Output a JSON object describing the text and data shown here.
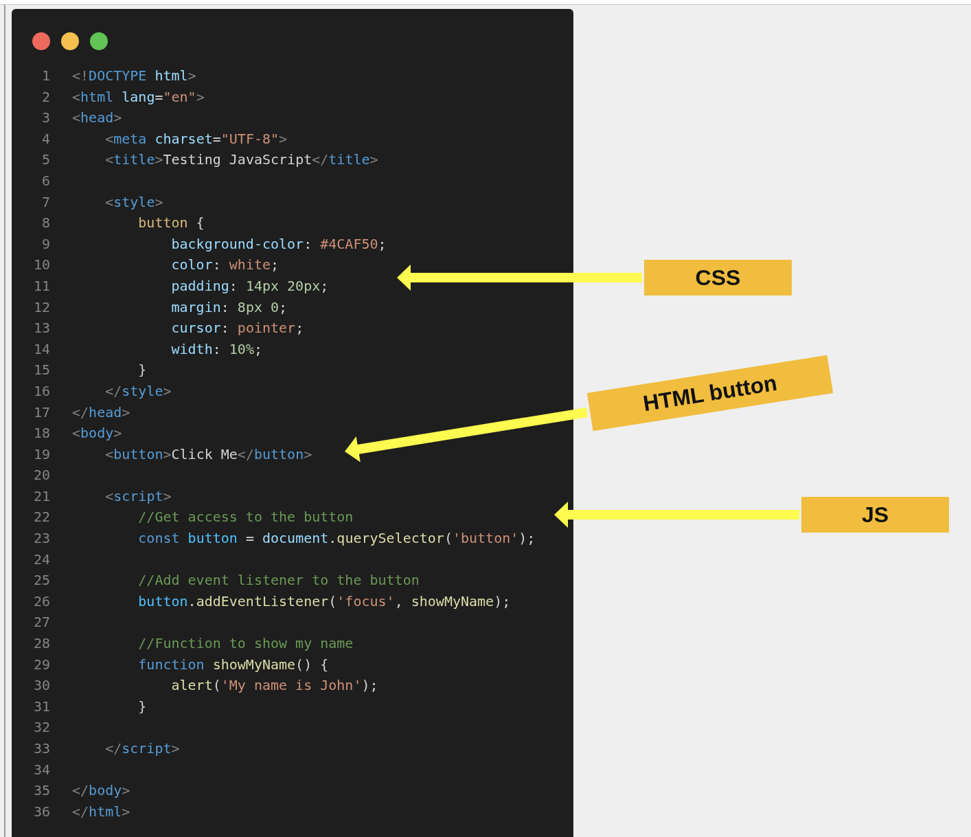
{
  "window": {
    "controls": [
      {
        "color": "#ed6a5e"
      },
      {
        "color": "#f5bf4f"
      },
      {
        "color": "#61c454"
      }
    ]
  },
  "code_lines": [
    {
      "number": "1",
      "tokens": [
        {
          "kind": "punct",
          "text": "<!"
        },
        {
          "kind": "tag",
          "text": "DOCTYPE"
        },
        {
          "kind": "attr",
          "text": " html"
        },
        {
          "kind": "punct",
          "text": ">"
        }
      ]
    },
    {
      "number": "2",
      "tokens": [
        {
          "kind": "punct",
          "text": "<"
        },
        {
          "kind": "tag",
          "text": "html"
        },
        {
          "kind": "attr",
          "text": " lang"
        },
        {
          "kind": "plain",
          "text": "="
        },
        {
          "kind": "string",
          "text": "\"en\""
        },
        {
          "kind": "punct",
          "text": ">"
        }
      ]
    },
    {
      "number": "3",
      "tokens": [
        {
          "kind": "punct",
          "text": "<"
        },
        {
          "kind": "tag",
          "text": "head"
        },
        {
          "kind": "punct",
          "text": ">"
        }
      ]
    },
    {
      "number": "4",
      "tokens": [
        {
          "kind": "punct",
          "text": "    <"
        },
        {
          "kind": "tag",
          "text": "meta"
        },
        {
          "kind": "attr",
          "text": " charset"
        },
        {
          "kind": "plain",
          "text": "="
        },
        {
          "kind": "string",
          "text": "\"UTF-8\""
        },
        {
          "kind": "punct",
          "text": ">"
        }
      ]
    },
    {
      "number": "5",
      "tokens": [
        {
          "kind": "punct",
          "text": "    <"
        },
        {
          "kind": "tag",
          "text": "title"
        },
        {
          "kind": "punct",
          "text": ">"
        },
        {
          "kind": "plain",
          "text": "Testing JavaScript"
        },
        {
          "kind": "punct",
          "text": "</"
        },
        {
          "kind": "tag",
          "text": "title"
        },
        {
          "kind": "punct",
          "text": ">"
        }
      ]
    },
    {
      "number": "6"
    },
    {
      "number": "7",
      "tokens": [
        {
          "kind": "punct",
          "text": "    <"
        },
        {
          "kind": "tag",
          "text": "style"
        },
        {
          "kind": "punct",
          "text": ">"
        }
      ]
    },
    {
      "number": "8",
      "tokens": [
        {
          "kind": "selector",
          "text": "        button"
        },
        {
          "kind": "plain",
          "text": " {"
        }
      ]
    },
    {
      "number": "9",
      "tokens": [
        {
          "kind": "attr",
          "text": "            background-color"
        },
        {
          "kind": "plain",
          "text": ": "
        },
        {
          "kind": "string",
          "text": "#4CAF50"
        },
        {
          "kind": "plain",
          "text": ";"
        }
      ]
    },
    {
      "number": "10",
      "tokens": [
        {
          "kind": "attr",
          "text": "            color"
        },
        {
          "kind": "plain",
          "text": ": "
        },
        {
          "kind": "string",
          "text": "white"
        },
        {
          "kind": "plain",
          "text": ";"
        }
      ]
    },
    {
      "number": "11",
      "tokens": [
        {
          "kind": "attr",
          "text": "            padding"
        },
        {
          "kind": "plain",
          "text": ": "
        },
        {
          "kind": "number",
          "text": "14px 20px"
        },
        {
          "kind": "plain",
          "text": ";"
        }
      ]
    },
    {
      "number": "12",
      "tokens": [
        {
          "kind": "attr",
          "text": "            margin"
        },
        {
          "kind": "plain",
          "text": ": "
        },
        {
          "kind": "number",
          "text": "8px 0"
        },
        {
          "kind": "plain",
          "text": ";"
        }
      ]
    },
    {
      "number": "13",
      "tokens": [
        {
          "kind": "attr",
          "text": "            cursor"
        },
        {
          "kind": "plain",
          "text": ": "
        },
        {
          "kind": "string",
          "text": "pointer"
        },
        {
          "kind": "plain",
          "text": ";"
        }
      ]
    },
    {
      "number": "14",
      "tokens": [
        {
          "kind": "attr",
          "text": "            width"
        },
        {
          "kind": "plain",
          "text": ": "
        },
        {
          "kind": "number",
          "text": "10%"
        },
        {
          "kind": "plain",
          "text": ";"
        }
      ]
    },
    {
      "number": "15",
      "tokens": [
        {
          "kind": "plain",
          "text": "        }"
        }
      ]
    },
    {
      "number": "16",
      "tokens": [
        {
          "kind": "punct",
          "text": "    </"
        },
        {
          "kind": "tag",
          "text": "style"
        },
        {
          "kind": "punct",
          "text": ">"
        }
      ]
    },
    {
      "number": "17",
      "tokens": [
        {
          "kind": "punct",
          "text": "</"
        },
        {
          "kind": "tag",
          "text": "head"
        },
        {
          "kind": "punct",
          "text": ">"
        }
      ]
    },
    {
      "number": "18",
      "tokens": [
        {
          "kind": "punct",
          "text": "<"
        },
        {
          "kind": "tag",
          "text": "body"
        },
        {
          "kind": "punct",
          "text": ">"
        }
      ]
    },
    {
      "number": "19",
      "tokens": [
        {
          "kind": "punct",
          "text": "    <"
        },
        {
          "kind": "tag",
          "text": "button"
        },
        {
          "kind": "punct",
          "text": ">"
        },
        {
          "kind": "plain",
          "text": "Click Me"
        },
        {
          "kind": "punct",
          "text": "</"
        },
        {
          "kind": "tag",
          "text": "button"
        },
        {
          "kind": "punct",
          "text": ">"
        }
      ]
    },
    {
      "number": "20"
    },
    {
      "number": "21",
      "tokens": [
        {
          "kind": "punct",
          "text": "    <"
        },
        {
          "kind": "tag",
          "text": "script"
        },
        {
          "kind": "punct",
          "text": ">"
        }
      ]
    },
    {
      "number": "22",
      "tokens": [
        {
          "kind": "comment",
          "text": "        //Get access to the button"
        }
      ]
    },
    {
      "number": "23",
      "tokens": [
        {
          "kind": "keyword",
          "text": "        const"
        },
        {
          "kind": "variable",
          "text": " button"
        },
        {
          "kind": "plain",
          "text": " = "
        },
        {
          "kind": "attr",
          "text": "document"
        },
        {
          "kind": "plain",
          "text": "."
        },
        {
          "kind": "function",
          "text": "querySelector"
        },
        {
          "kind": "plain",
          "text": "("
        },
        {
          "kind": "string",
          "text": "'button'"
        },
        {
          "kind": "plain",
          "text": ");"
        }
      ]
    },
    {
      "number": "24"
    },
    {
      "number": "25",
      "tokens": [
        {
          "kind": "comment",
          "text": "        //Add event listener to the button"
        }
      ]
    },
    {
      "number": "26",
      "tokens": [
        {
          "kind": "variable",
          "text": "        button"
        },
        {
          "kind": "plain",
          "text": "."
        },
        {
          "kind": "function",
          "text": "addEventListener"
        },
        {
          "kind": "plain",
          "text": "("
        },
        {
          "kind": "string",
          "text": "'focus'"
        },
        {
          "kind": "plain",
          "text": ", "
        },
        {
          "kind": "function",
          "text": "showMyName"
        },
        {
          "kind": "plain",
          "text": ");"
        }
      ]
    },
    {
      "number": "27"
    },
    {
      "number": "28",
      "tokens": [
        {
          "kind": "comment",
          "text": "        //Function to show my name"
        }
      ]
    },
    {
      "number": "29",
      "tokens": [
        {
          "kind": "keyword",
          "text": "        function"
        },
        {
          "kind": "function",
          "text": " showMyName"
        },
        {
          "kind": "plain",
          "text": "() {"
        }
      ]
    },
    {
      "number": "30",
      "tokens": [
        {
          "kind": "function",
          "text": "            alert"
        },
        {
          "kind": "plain",
          "text": "("
        },
        {
          "kind": "string",
          "text": "'My name is John'"
        },
        {
          "kind": "plain",
          "text": ");"
        }
      ]
    },
    {
      "number": "31",
      "tokens": [
        {
          "kind": "plain",
          "text": "        }"
        }
      ]
    },
    {
      "number": "32"
    },
    {
      "number": "33",
      "tokens": [
        {
          "kind": "punct",
          "text": "    </"
        },
        {
          "kind": "tag",
          "text": "script"
        },
        {
          "kind": "punct",
          "text": ">"
        }
      ]
    },
    {
      "number": "34"
    },
    {
      "number": "35",
      "tokens": [
        {
          "kind": "punct",
          "text": "</"
        },
        {
          "kind": "tag",
          "text": "body"
        },
        {
          "kind": "punct",
          "text": ">"
        }
      ]
    },
    {
      "number": "36",
      "tokens": [
        {
          "kind": "punct",
          "text": "</"
        },
        {
          "kind": "tag",
          "text": "html"
        },
        {
          "kind": "punct",
          "text": ">"
        }
      ]
    }
  ],
  "annotations": [
    {
      "label": "CSS",
      "kind": "css"
    },
    {
      "label": "HTML button",
      "kind": "html"
    },
    {
      "label": "JS",
      "kind": "js"
    }
  ]
}
